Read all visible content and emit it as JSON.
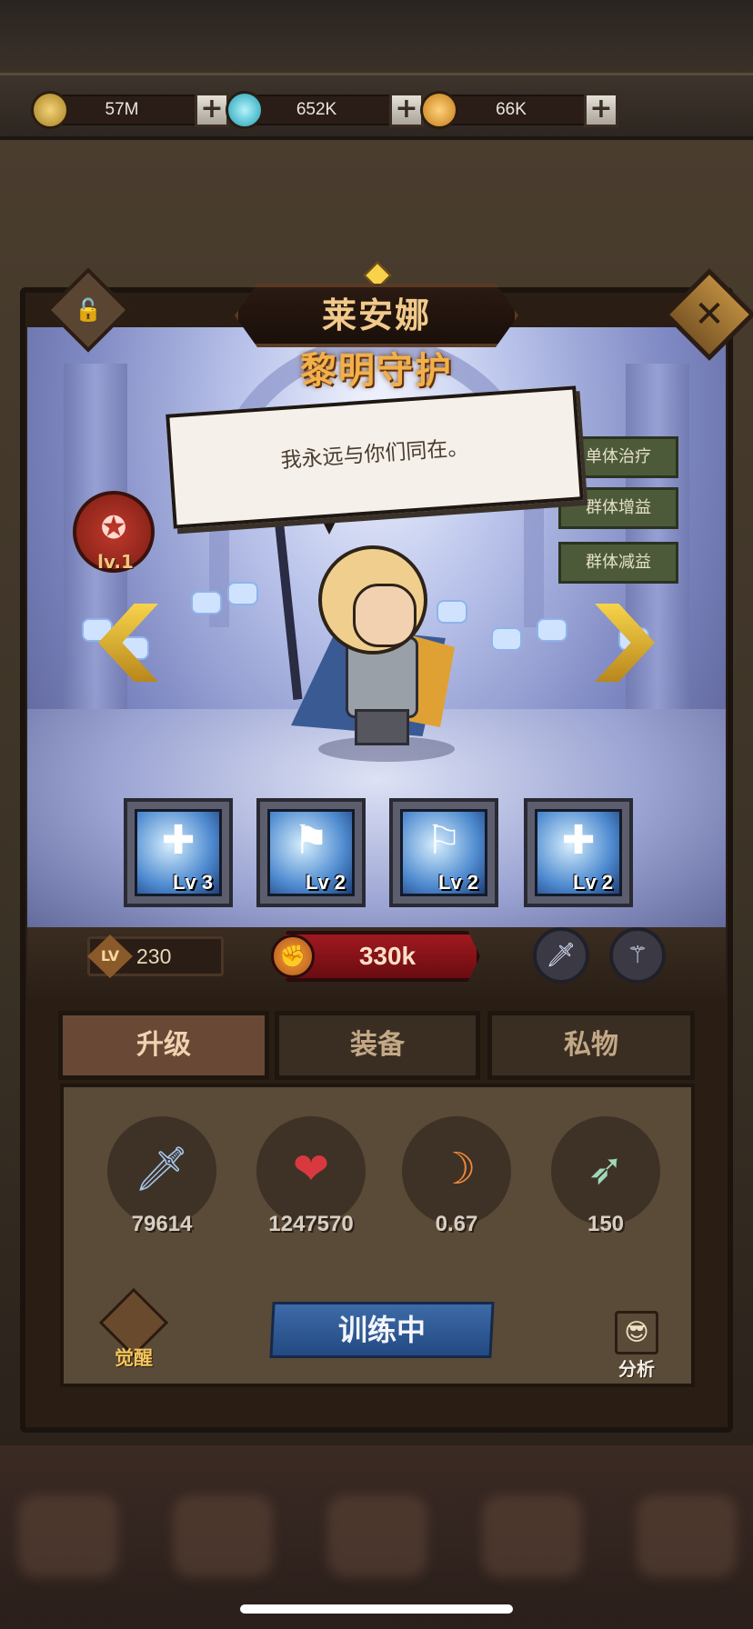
{
  "resources": [
    {
      "name": "coin",
      "amount": "57M",
      "color": "#d7b35a",
      "icon": "coin-icon"
    },
    {
      "name": "gem",
      "amount": "652K",
      "color": "#3fc6d8",
      "icon": "crystal-icon"
    },
    {
      "name": "medal",
      "amount": "66K",
      "color": "#e9a43a",
      "icon": "medal-icon"
    }
  ],
  "hero": {
    "name": "莱安娜",
    "title": "黎明守护",
    "speech": "我永远与你们同在。",
    "roles": [
      "单体治疗",
      "群体增益",
      "群体减益"
    ],
    "emblem_level": "lv.1",
    "level_label": "LV",
    "level": "230",
    "power": "330k"
  },
  "skills": [
    {
      "level": "Lv 3",
      "icon": "shield-flag-icon"
    },
    {
      "level": "Lv 2",
      "icon": "swirl-flag-icon"
    },
    {
      "level": "Lv 2",
      "icon": "banner-icon"
    },
    {
      "level": "Lv 2",
      "icon": "cross-flag-icon"
    }
  ],
  "tabs": [
    "升级",
    "装备",
    "私物"
  ],
  "active_tab": "升级",
  "stats": [
    {
      "name": "attack",
      "value": "79614",
      "icon": "sword-icon"
    },
    {
      "name": "health",
      "value": "1247570",
      "icon": "heart-icon"
    },
    {
      "name": "attack-speed",
      "value": "0.67",
      "icon": "crescent-blade-icon"
    },
    {
      "name": "range",
      "value": "150",
      "icon": "arrow-icon"
    }
  ],
  "actions": {
    "awaken": "觉醒",
    "train": "训练中",
    "analyze": "分析"
  },
  "glyphs": {
    "plus": "+",
    "close": "✕",
    "lock": "🔓",
    "pentagram": "✪",
    "fist": "✊",
    "sword": "🗡",
    "staff": "⚚",
    "heart": "❤",
    "blade": "☽",
    "arrow": "➶",
    "analyze": "😎"
  }
}
